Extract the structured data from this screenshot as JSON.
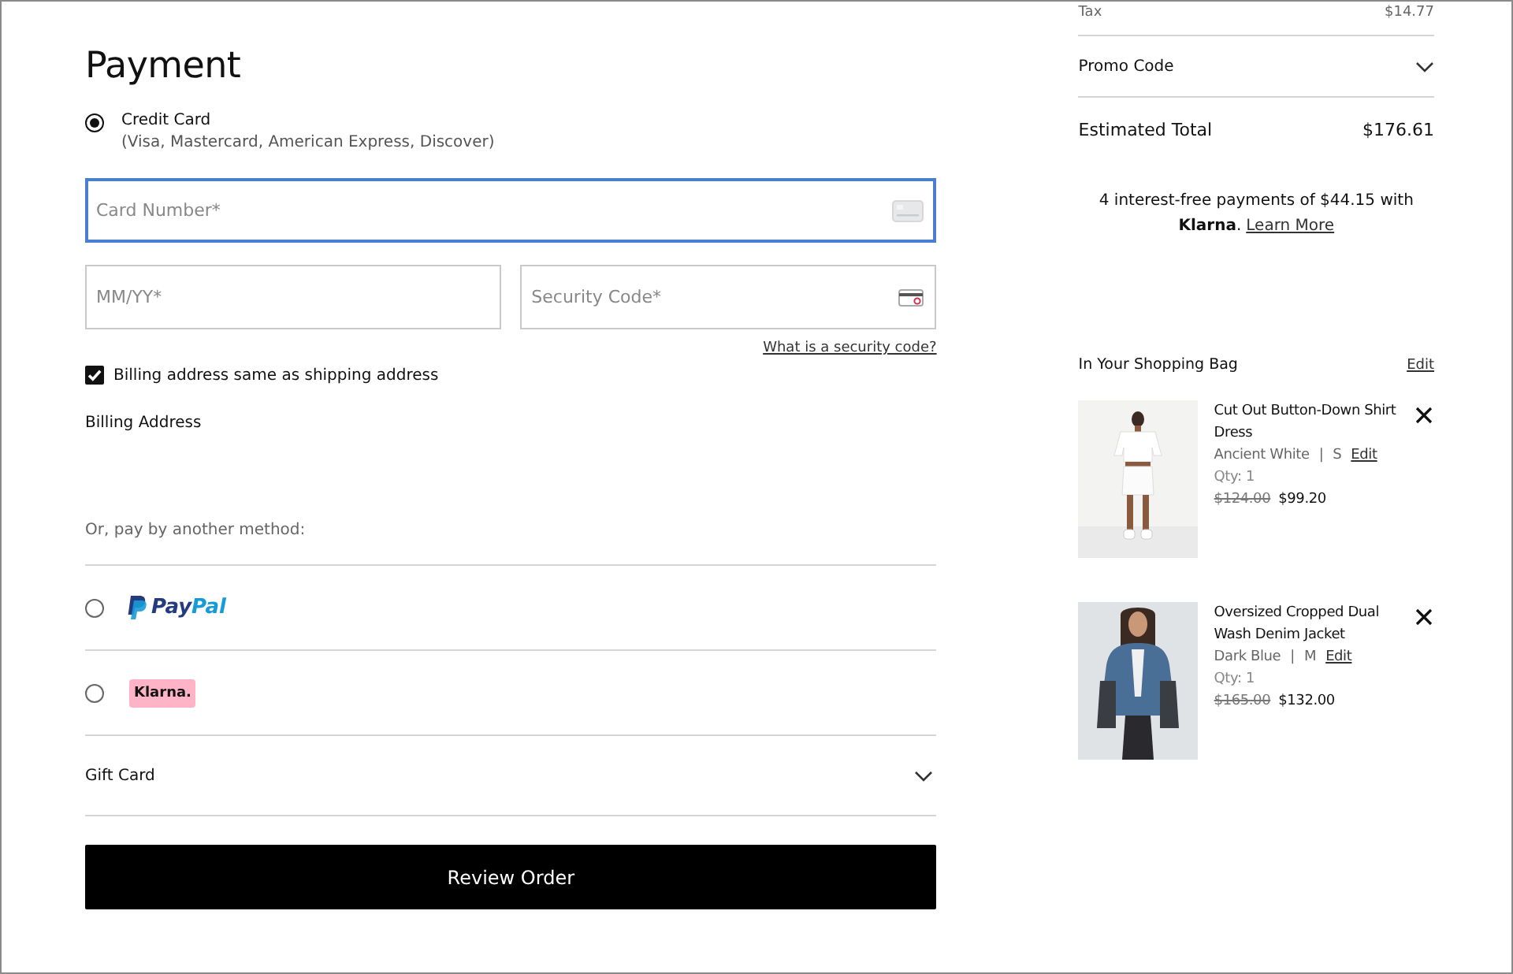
{
  "payment": {
    "title": "Payment",
    "credit_card": {
      "label": "Credit Card",
      "note": "(Visa, Mastercard, American Express, Discover)",
      "selected": true
    },
    "fields": [
      {
        "placeholder": "Card Number*",
        "focused": true
      },
      {
        "placeholder": "MM/YY*",
        "focused": false
      },
      {
        "placeholder": "Security Code*",
        "focused": false
      }
    ],
    "security_link": "What is a security code?",
    "billing_same": {
      "label": "Billing address same as shipping address",
      "checked": true
    },
    "billing_heading": "Billing Address",
    "other_heading": "Or, pay by another method:",
    "methods": [
      {
        "kind": "paypal",
        "label": "Pay",
        "label_2": "Pal",
        "selected": false
      },
      {
        "kind": "klarna",
        "label": "Klarna.",
        "selected": false
      }
    ],
    "gift_card": "Gift Card",
    "button": "Review Order"
  },
  "summary": {
    "tax_label": "Tax",
    "tax_value": "$14.77",
    "promo": "Promo Code",
    "total_label": "Estimated Total",
    "total_value": "$176.61",
    "klarna_text": "4 interest-free payments of $44.15 with",
    "klarna_brand": "Klarna",
    "klarna_sep": ".",
    "learn_more": "Learn More",
    "bag_title": "In Your Shopping Bag",
    "bag_edit": "Edit",
    "items": [
      {
        "name": "Cut Out Button-Down Shirt Dress",
        "shade": "Ancient White",
        "sep": "|",
        "size": "S",
        "edit": "Edit",
        "qty": "Qty: 1",
        "old_price": "$124.00",
        "price": "$99.20"
      },
      {
        "name": "Oversized Cropped Dual Wash Denim Jacket",
        "shade": "Dark Blue",
        "sep": "|",
        "size": "M",
        "edit": "Edit",
        "qty": "Qty: 1",
        "old_price": "$165.00",
        "price": "$132.00"
      }
    ]
  }
}
